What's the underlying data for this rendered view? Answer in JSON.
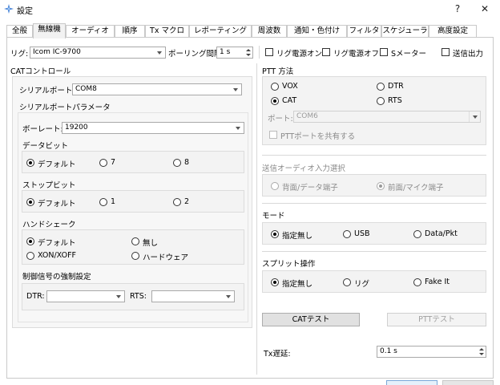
{
  "window": {
    "title": "設定",
    "help_label": "?",
    "close_label": "✕"
  },
  "tabs": [
    {
      "label": "全般"
    },
    {
      "label": "無線機"
    },
    {
      "label": "オーディオ"
    },
    {
      "label": "順序"
    },
    {
      "label": "Tx マクロ"
    },
    {
      "label": "レポーティング"
    },
    {
      "label": "周波数"
    },
    {
      "label": "通知・色付け"
    },
    {
      "label": "フィルタ"
    },
    {
      "label": "スケジューラ"
    },
    {
      "label": "高度設定"
    }
  ],
  "top": {
    "rig_label": "リグ:",
    "rig_value": "Icom IC-9700",
    "polling_label": "ポーリング間隔:",
    "polling_value": "1 s",
    "rig_power_on": "リグ電源オン",
    "rig_power_off": "リグ電源オフ",
    "s_meter": "Sメーター",
    "tx_output": "送信出力"
  },
  "cat": {
    "section_title": "CATコントロール",
    "serial_port_label": "シリアルポート:",
    "serial_port_value": "COM8",
    "serial_params_label": "シリアルポートパラメータ",
    "baud_label": "ボーレート:",
    "baud_value": "19200",
    "databits_label": "データビット",
    "databits_options": [
      "デフォルト",
      "7",
      "8"
    ],
    "stopbits_label": "ストップビット",
    "stopbits_options": [
      "デフォルト",
      "1",
      "2"
    ],
    "handshake_label": "ハンドシェーク",
    "handshake_options": [
      "デフォルト",
      "無し",
      "XON/XOFF",
      "ハードウェア"
    ],
    "force_label": "制御信号の強制設定",
    "dtr_label": "DTR:",
    "rts_label": "RTS:"
  },
  "ptt": {
    "section_title": "PTT 方法",
    "options": [
      "VOX",
      "DTR",
      "CAT",
      "RTS"
    ],
    "port_label": "ポート:",
    "port_value": "COM6",
    "share_label": "PTTポートを共有する"
  },
  "audio_in": {
    "section_title": "送信オーディオ入力選択",
    "options": [
      "背面/データ端子",
      "前面/マイク端子"
    ]
  },
  "mode": {
    "section_title": "モード",
    "options": [
      "指定無し",
      "USB",
      "Data/Pkt"
    ]
  },
  "split": {
    "section_title": "スプリット操作",
    "options": [
      "指定無し",
      "リグ",
      "Fake It"
    ]
  },
  "buttons": {
    "cat_test": "CATテスト",
    "ptt_test": "PTTテスト"
  },
  "tx_delay": {
    "label": "Tx遅延:",
    "value": "0.1 s"
  }
}
